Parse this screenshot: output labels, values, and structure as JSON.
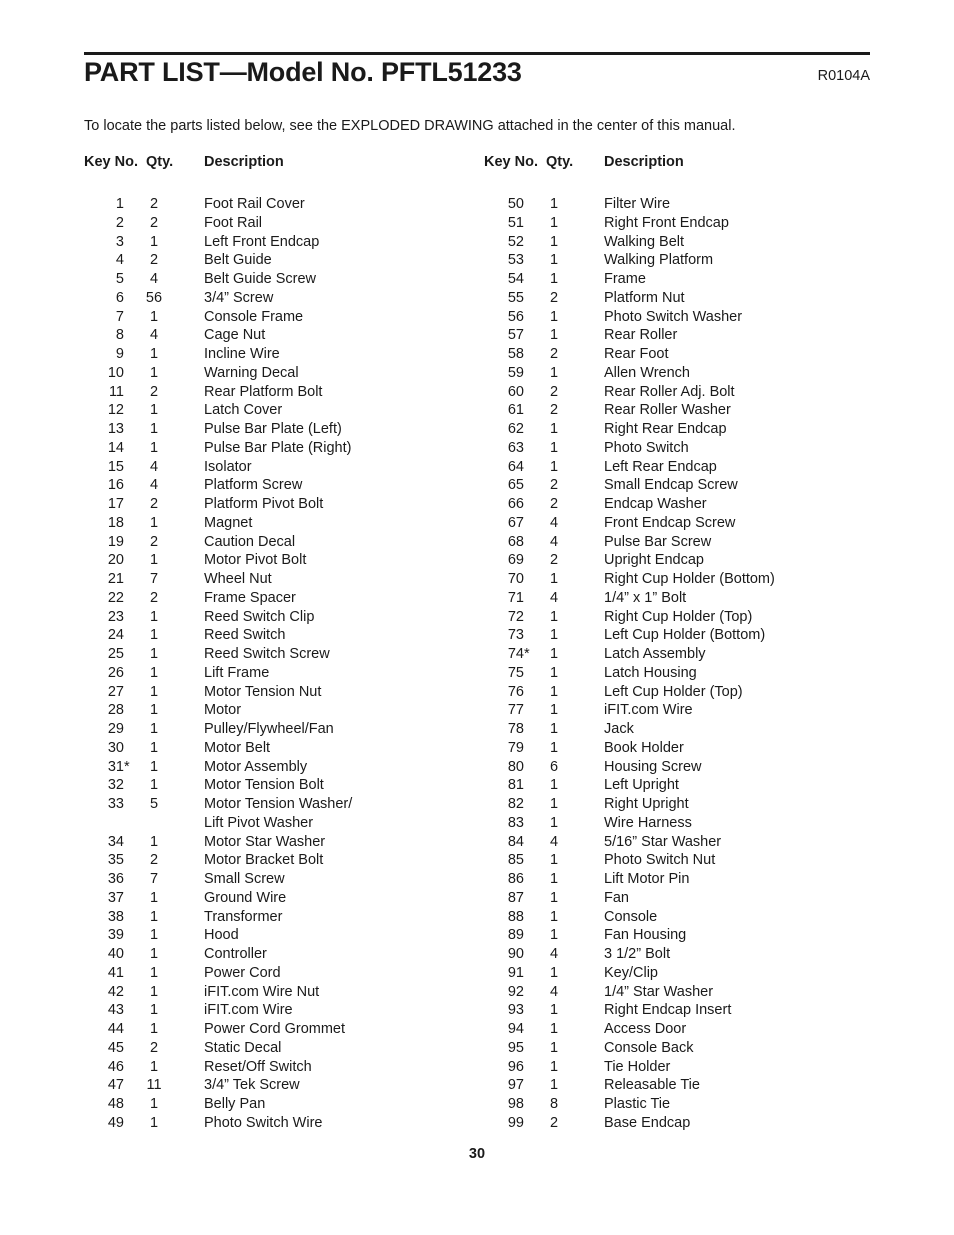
{
  "document": {
    "title": "PART LIST—Model No. PFTL51233",
    "revision_code": "R0104A",
    "intro": "To locate the parts listed below, see the EXPLODED DRAWING attached in the center of this manual.",
    "page_number": "30"
  },
  "table": {
    "headers": {
      "key_no": "Key No.",
      "qty": "Qty.",
      "description": "Description"
    },
    "left_column": [
      {
        "key": "1",
        "qty": "2",
        "desc": "Foot Rail Cover"
      },
      {
        "key": "2",
        "qty": "2",
        "desc": "Foot Rail"
      },
      {
        "key": "3",
        "qty": "1",
        "desc": "Left Front Endcap"
      },
      {
        "key": "4",
        "qty": "2",
        "desc": "Belt Guide"
      },
      {
        "key": "5",
        "qty": "4",
        "desc": "Belt Guide Screw"
      },
      {
        "key": "6",
        "qty": "56",
        "desc": "3/4” Screw"
      },
      {
        "key": "7",
        "qty": "1",
        "desc": "Console Frame"
      },
      {
        "key": "8",
        "qty": "4",
        "desc": "Cage Nut"
      },
      {
        "key": "9",
        "qty": "1",
        "desc": "Incline Wire"
      },
      {
        "key": "10",
        "qty": "1",
        "desc": "Warning Decal"
      },
      {
        "key": "11",
        "qty": "2",
        "desc": "Rear Platform Bolt"
      },
      {
        "key": "12",
        "qty": "1",
        "desc": "Latch Cover"
      },
      {
        "key": "13",
        "qty": "1",
        "desc": "Pulse Bar Plate (Left)"
      },
      {
        "key": "14",
        "qty": "1",
        "desc": "Pulse Bar Plate (Right)"
      },
      {
        "key": "15",
        "qty": "4",
        "desc": "Isolator"
      },
      {
        "key": "16",
        "qty": "4",
        "desc": "Platform Screw"
      },
      {
        "key": "17",
        "qty": "2",
        "desc": "Platform Pivot Bolt"
      },
      {
        "key": "18",
        "qty": "1",
        "desc": "Magnet"
      },
      {
        "key": "19",
        "qty": "2",
        "desc": "Caution Decal"
      },
      {
        "key": "20",
        "qty": "1",
        "desc": "Motor Pivot Bolt"
      },
      {
        "key": "21",
        "qty": "7",
        "desc": "Wheel Nut"
      },
      {
        "key": "22",
        "qty": "2",
        "desc": "Frame Spacer"
      },
      {
        "key": "23",
        "qty": "1",
        "desc": "Reed Switch Clip"
      },
      {
        "key": "24",
        "qty": "1",
        "desc": "Reed Switch"
      },
      {
        "key": "25",
        "qty": "1",
        "desc": "Reed Switch Screw"
      },
      {
        "key": "26",
        "qty": "1",
        "desc": "Lift Frame"
      },
      {
        "key": "27",
        "qty": "1",
        "desc": "Motor Tension Nut"
      },
      {
        "key": "28",
        "qty": "1",
        "desc": "Motor"
      },
      {
        "key": "29",
        "qty": "1",
        "desc": "Pulley/Flywheel/Fan"
      },
      {
        "key": "30",
        "qty": "1",
        "desc": "Motor Belt"
      },
      {
        "key": "31*",
        "qty": "1",
        "desc": "Motor Assembly"
      },
      {
        "key": "32",
        "qty": "1",
        "desc": "Motor Tension Bolt"
      },
      {
        "key": "33",
        "qty": "5",
        "desc": "Motor Tension Washer/"
      },
      {
        "key": "",
        "qty": "",
        "desc": "Lift Pivot Washer",
        "continuation": true
      },
      {
        "key": "34",
        "qty": "1",
        "desc": "Motor Star Washer"
      },
      {
        "key": "35",
        "qty": "2",
        "desc": "Motor Bracket Bolt"
      },
      {
        "key": "36",
        "qty": "7",
        "desc": "Small Screw"
      },
      {
        "key": "37",
        "qty": "1",
        "desc": "Ground Wire"
      },
      {
        "key": "38",
        "qty": "1",
        "desc": "Transformer"
      },
      {
        "key": "39",
        "qty": "1",
        "desc": "Hood"
      },
      {
        "key": "40",
        "qty": "1",
        "desc": "Controller"
      },
      {
        "key": "41",
        "qty": "1",
        "desc": "Power Cord"
      },
      {
        "key": "42",
        "qty": "1",
        "desc": "iFIT.com Wire Nut"
      },
      {
        "key": "43",
        "qty": "1",
        "desc": "iFIT.com Wire"
      },
      {
        "key": "44",
        "qty": "1",
        "desc": "Power Cord Grommet"
      },
      {
        "key": "45",
        "qty": "2",
        "desc": "Static Decal"
      },
      {
        "key": "46",
        "qty": "1",
        "desc": "Reset/Off Switch"
      },
      {
        "key": "47",
        "qty": "11",
        "desc": "3/4” Tek Screw"
      },
      {
        "key": "48",
        "qty": "1",
        "desc": "Belly Pan"
      },
      {
        "key": "49",
        "qty": "1",
        "desc": "Photo Switch Wire"
      }
    ],
    "right_column": [
      {
        "key": "50",
        "qty": "1",
        "desc": "Filter Wire"
      },
      {
        "key": "51",
        "qty": "1",
        "desc": "Right Front Endcap"
      },
      {
        "key": "52",
        "qty": "1",
        "desc": "Walking Belt"
      },
      {
        "key": "53",
        "qty": "1",
        "desc": "Walking Platform"
      },
      {
        "key": "54",
        "qty": "1",
        "desc": "Frame"
      },
      {
        "key": "55",
        "qty": "2",
        "desc": "Platform Nut"
      },
      {
        "key": "56",
        "qty": "1",
        "desc": "Photo Switch Washer"
      },
      {
        "key": "57",
        "qty": "1",
        "desc": "Rear Roller"
      },
      {
        "key": "58",
        "qty": "2",
        "desc": "Rear Foot"
      },
      {
        "key": "59",
        "qty": "1",
        "desc": "Allen Wrench"
      },
      {
        "key": "60",
        "qty": "2",
        "desc": "Rear Roller Adj. Bolt"
      },
      {
        "key": "61",
        "qty": "2",
        "desc": "Rear Roller Washer"
      },
      {
        "key": "62",
        "qty": "1",
        "desc": "Right Rear Endcap"
      },
      {
        "key": "63",
        "qty": "1",
        "desc": "Photo Switch"
      },
      {
        "key": "64",
        "qty": "1",
        "desc": "Left Rear Endcap"
      },
      {
        "key": "65",
        "qty": "2",
        "desc": "Small Endcap Screw"
      },
      {
        "key": "66",
        "qty": "2",
        "desc": "Endcap Washer"
      },
      {
        "key": "67",
        "qty": "4",
        "desc": "Front Endcap Screw"
      },
      {
        "key": "68",
        "qty": "4",
        "desc": "Pulse Bar Screw"
      },
      {
        "key": "69",
        "qty": "2",
        "desc": "Upright Endcap"
      },
      {
        "key": "70",
        "qty": "1",
        "desc": "Right Cup Holder (Bottom)"
      },
      {
        "key": "71",
        "qty": "4",
        "desc": "1/4” x 1” Bolt"
      },
      {
        "key": "72",
        "qty": "1",
        "desc": "Right Cup Holder (Top)"
      },
      {
        "key": "73",
        "qty": "1",
        "desc": "Left Cup Holder (Bottom)"
      },
      {
        "key": "74*",
        "qty": "1",
        "desc": "Latch Assembly"
      },
      {
        "key": "75",
        "qty": "1",
        "desc": "Latch Housing"
      },
      {
        "key": "76",
        "qty": "1",
        "desc": "Left Cup Holder (Top)"
      },
      {
        "key": "77",
        "qty": "1",
        "desc": "iFIT.com Wire"
      },
      {
        "key": "78",
        "qty": "1",
        "desc": "Jack"
      },
      {
        "key": "79",
        "qty": "1",
        "desc": "Book Holder"
      },
      {
        "key": "80",
        "qty": "6",
        "desc": "Housing Screw"
      },
      {
        "key": "81",
        "qty": "1",
        "desc": "Left Upright"
      },
      {
        "key": "82",
        "qty": "1",
        "desc": "Right Upright"
      },
      {
        "key": "83",
        "qty": "1",
        "desc": "Wire Harness"
      },
      {
        "key": "84",
        "qty": "4",
        "desc": "5/16” Star Washer"
      },
      {
        "key": "85",
        "qty": "1",
        "desc": "Photo Switch Nut"
      },
      {
        "key": "86",
        "qty": "1",
        "desc": "Lift Motor Pin"
      },
      {
        "key": "87",
        "qty": "1",
        "desc": "Fan"
      },
      {
        "key": "88",
        "qty": "1",
        "desc": "Console"
      },
      {
        "key": "89",
        "qty": "1",
        "desc": "Fan Housing"
      },
      {
        "key": "90",
        "qty": "4",
        "desc": "3 1/2” Bolt"
      },
      {
        "key": "91",
        "qty": "1",
        "desc": "Key/Clip"
      },
      {
        "key": "92",
        "qty": "4",
        "desc": "1/4” Star Washer"
      },
      {
        "key": "93",
        "qty": "1",
        "desc": "Right Endcap Insert"
      },
      {
        "key": "94",
        "qty": "1",
        "desc": "Access Door"
      },
      {
        "key": "95",
        "qty": "1",
        "desc": "Console Back"
      },
      {
        "key": "96",
        "qty": "1",
        "desc": "Tie Holder"
      },
      {
        "key": "97",
        "qty": "1",
        "desc": "Releasable Tie"
      },
      {
        "key": "98",
        "qty": "8",
        "desc": "Plastic Tie"
      },
      {
        "key": "99",
        "qty": "2",
        "desc": "Base Endcap"
      }
    ]
  }
}
